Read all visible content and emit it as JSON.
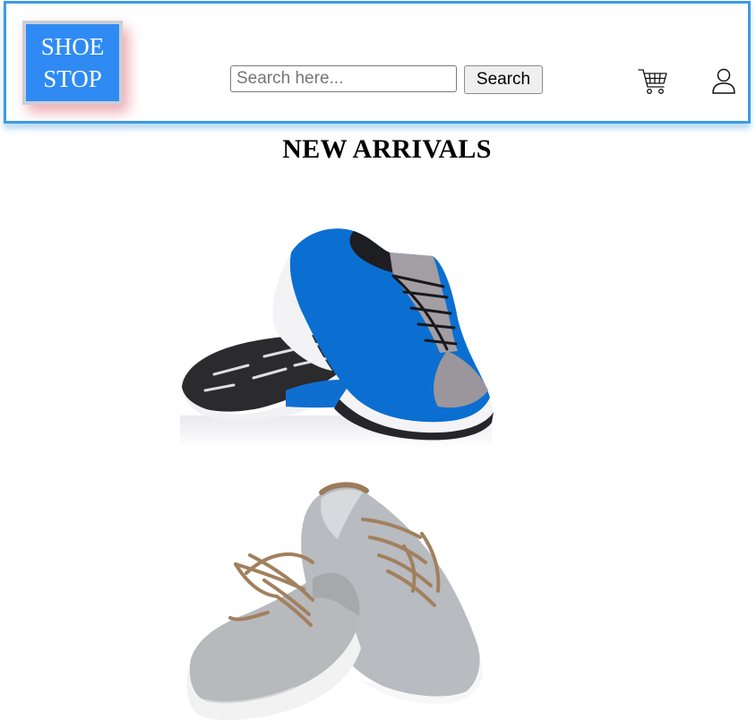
{
  "header": {
    "logo": {
      "line1": "SHOE",
      "line2": "STOP"
    },
    "search": {
      "placeholder": "Search here...",
      "value": "",
      "button_label": "Search"
    },
    "icons": {
      "cart": "shopping-cart-icon",
      "user": "user-icon"
    }
  },
  "main": {
    "title": "NEW ARRIVALS",
    "products": [
      {
        "image": "blue-running-sneakers",
        "colors": {
          "upper": "#0b6fd1",
          "sole": "#2a2a2a",
          "accent": "#9e9aa0"
        }
      },
      {
        "image": "grey-canvas-sneakers",
        "colors": {
          "upper": "#b9bcbf",
          "laces": "#a2805e",
          "sole": "#f4f4f4"
        }
      }
    ]
  },
  "colors": {
    "header_border": "#3d9be6",
    "logo_bg": "#2f8bf3"
  }
}
